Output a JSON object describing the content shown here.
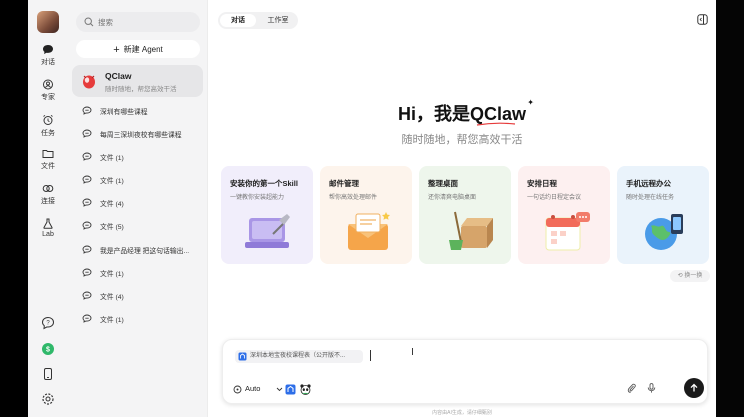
{
  "rail": {
    "items": [
      {
        "label": "对话",
        "icon": "chat-icon"
      },
      {
        "label": "专家",
        "icon": "expert-icon"
      },
      {
        "label": "任务",
        "icon": "alarm-clock-icon"
      },
      {
        "label": "文件",
        "icon": "folder-icon"
      },
      {
        "label": "连接",
        "icon": "link-icon"
      },
      {
        "label": "Lab",
        "icon": "flask-icon"
      }
    ],
    "bottom_icons": [
      "help-icon",
      "coin-icon",
      "phone-icon",
      "settings-icon"
    ]
  },
  "sidebar": {
    "search_placeholder": "搜索",
    "new_agent_label": "新建 Agent",
    "agent": {
      "name": "QClaw",
      "desc": "随时随地，帮您高效干活"
    },
    "conversations": [
      "深圳有哪些课程",
      "每周三深圳夜校有哪些课程",
      "文件 (1)",
      "文件 (1)",
      "文件 (4)",
      "文件 (5)",
      "我是产品经理 把这句话输出...",
      "文件 (1)",
      "文件 (4)",
      "文件 (1)"
    ]
  },
  "main": {
    "tabs": [
      "对话",
      "工作室"
    ],
    "hero_prefix": "Hi，我是",
    "hero_brand": "QClaw",
    "hero_sub": "随时随地，帮您高效干活",
    "cards": [
      {
        "title": "安装你的第一个Skill",
        "desc": "一键教你安装超能力",
        "bg": "#f1eefb"
      },
      {
        "title": "邮件管理",
        "desc": "帮你高效处理邮件",
        "bg": "#fdf4ec"
      },
      {
        "title": "整理桌面",
        "desc": "还你清爽电脑桌面",
        "bg": "#eef6ec"
      },
      {
        "title": "安排日程",
        "desc": "一句话约日程定会议",
        "bg": "#fdf0f0"
      },
      {
        "title": "手机远程办公",
        "desc": "随时处理在线任务",
        "bg": "#eaf3fb"
      }
    ],
    "refresh_label": "换一换",
    "composer": {
      "attachment": "深圳本地宝夜校课程表（公开版不...",
      "model": "Auto"
    },
    "footer_note": "内容由AI生成，请仔细甄别"
  }
}
